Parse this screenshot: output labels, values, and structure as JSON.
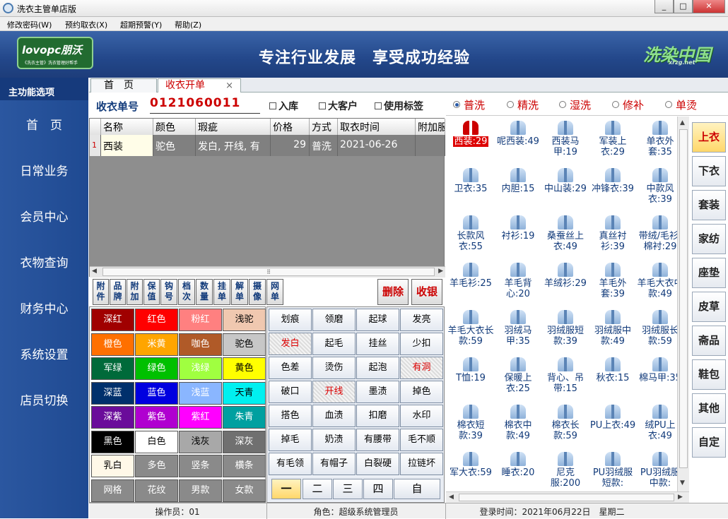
{
  "window": {
    "title": "洗衣主管单店版",
    "min": "0",
    "max": "1",
    "close": "r"
  },
  "menu": [
    "修改密码(W)",
    "预约取衣(X)",
    "超期预警(Y)",
    "帮助(Z)"
  ],
  "banner": {
    "logo_left": "lovopc朋沃",
    "logo_left_sub": "《洗衣主管》洗衣管理好帮手",
    "slogan": "专注行业发展　享受成功经验",
    "logo_right": "洗染中国",
    "logo_right_sub": "xrzg.net"
  },
  "sidebar": {
    "header": "主功能选项",
    "items": [
      "首　页",
      "日常业务",
      "会员中心",
      "衣物查询",
      "财务中心",
      "系统设置",
      "店员切换"
    ]
  },
  "tabs": [
    {
      "label": "首　页"
    },
    {
      "label": "收衣开单",
      "close": "×"
    }
  ],
  "form": {
    "order_label": "收衣单号",
    "order_no": "0121060011",
    "checks": [
      "入库",
      "大客户",
      "使用标签"
    ]
  },
  "grid": {
    "headers": [
      "名称",
      "颜色",
      "瑕疵",
      "价格",
      "方式",
      "取衣时间",
      "附加服"
    ],
    "row": {
      "index": "1",
      "name": "西装",
      "color": "驼色",
      "defect": "发白, 开线, 有",
      "price": "29",
      "method": "普洗",
      "time": "2021-06-26"
    },
    "scroll_grip": "⠿"
  },
  "toolbar": {
    "buttons": [
      "附件",
      "品牌",
      "附加",
      "保值",
      "钩号",
      "档次",
      "数量",
      "挂单",
      "解单",
      "摄像",
      "网单"
    ],
    "delete": "删除",
    "checkout": "收银"
  },
  "colors": [
    {
      "n": "深红",
      "bg": "#a00000",
      "fg": "#fff"
    },
    {
      "n": "红色",
      "bg": "#ff0000",
      "fg": "#fff"
    },
    {
      "n": "粉红",
      "bg": "#ff8080",
      "fg": "#fff"
    },
    {
      "n": "浅驼",
      "bg": "#f0c8b0",
      "fg": "#000"
    },
    {
      "n": "橙色",
      "bg": "#ff7000",
      "fg": "#fff"
    },
    {
      "n": "米黄",
      "bg": "#ffa500",
      "fg": "#fff"
    },
    {
      "n": "咖色",
      "bg": "#b05a28",
      "fg": "#fff"
    },
    {
      "n": "驼色",
      "bg": "#c7c7c7",
      "fg": "#000"
    },
    {
      "n": "军绿",
      "bg": "#006a3a",
      "fg": "#fff"
    },
    {
      "n": "绿色",
      "bg": "#00c000",
      "fg": "#fff"
    },
    {
      "n": "浅绿",
      "bg": "#a0ff40",
      "fg": "#fff"
    },
    {
      "n": "黄色",
      "bg": "#ffff00",
      "fg": "#000"
    },
    {
      "n": "深蓝",
      "bg": "#00306c",
      "fg": "#fff"
    },
    {
      "n": "蓝色",
      "bg": "#0000e0",
      "fg": "#fff"
    },
    {
      "n": "浅蓝",
      "bg": "#8ab6ff",
      "fg": "#fff"
    },
    {
      "n": "天青",
      "bg": "#00f0f0",
      "fg": "#000"
    },
    {
      "n": "深紫",
      "bg": "#6a0c9a",
      "fg": "#fff"
    },
    {
      "n": "紫色",
      "bg": "#b000d0",
      "fg": "#fff"
    },
    {
      "n": "紫红",
      "bg": "#ff00ff",
      "fg": "#fff"
    },
    {
      "n": "朱青",
      "bg": "#00a0a0",
      "fg": "#fff"
    },
    {
      "n": "黑色",
      "bg": "#000000",
      "fg": "#fff"
    },
    {
      "n": "白色",
      "bg": "#ffffff",
      "fg": "#000"
    },
    {
      "n": "浅灰",
      "bg": "#a8a8a8",
      "fg": "#000"
    },
    {
      "n": "深灰",
      "bg": "#707070",
      "fg": "#fff"
    },
    {
      "n": "乳白",
      "bg": "#fff8e8",
      "fg": "#000"
    },
    {
      "n": "多色",
      "bg": "#8a8a8a",
      "fg": "#fff"
    },
    {
      "n": "竖条",
      "bg": "#8a8a8a",
      "fg": "#fff"
    },
    {
      "n": "横条",
      "bg": "#8a8a8a",
      "fg": "#fff"
    },
    {
      "n": "网格",
      "bg": "#8a8a8a",
      "fg": "#fff"
    },
    {
      "n": "花纹",
      "bg": "#8a8a8a",
      "fg": "#fff"
    },
    {
      "n": "男款",
      "bg": "#8a8a8a",
      "fg": "#fff"
    },
    {
      "n": "女款",
      "bg": "#8a8a8a",
      "fg": "#fff"
    }
  ],
  "defects": [
    {
      "n": "划痕"
    },
    {
      "n": "领磨"
    },
    {
      "n": "起球"
    },
    {
      "n": "发亮"
    },
    {
      "n": "发白",
      "sel": true
    },
    {
      "n": "起毛"
    },
    {
      "n": "挂丝"
    },
    {
      "n": "少扣"
    },
    {
      "n": "色差"
    },
    {
      "n": "烫伤"
    },
    {
      "n": "起泡"
    },
    {
      "n": "有洞",
      "sel": true
    },
    {
      "n": "破口"
    },
    {
      "n": "开线",
      "sel": true
    },
    {
      "n": "墨渍"
    },
    {
      "n": "掉色"
    },
    {
      "n": "搭色"
    },
    {
      "n": "血渍"
    },
    {
      "n": "扣磨"
    },
    {
      "n": "水印"
    },
    {
      "n": "掉毛"
    },
    {
      "n": "奶渍"
    },
    {
      "n": "有腰带"
    },
    {
      "n": "毛不顺"
    },
    {
      "n": "有毛领"
    },
    {
      "n": "有帽子"
    },
    {
      "n": "白裂硬"
    },
    {
      "n": "拉链坏"
    }
  ],
  "pager": [
    "一",
    "二",
    "三",
    "四",
    "自"
  ],
  "wash_modes": [
    "普洗",
    "精洗",
    "湿洗",
    "修补",
    "单烫"
  ],
  "items": [
    "西装:29",
    "呢西装:49",
    "西装马甲:19",
    "军装上衣:29",
    "单衣外套:35",
    "卫衣:35",
    "内胆:15",
    "中山装:29",
    "冲锋衣:39",
    "中款风衣:39",
    "长款风衣:55",
    "衬衫:19",
    "桑蚕丝上衣:49",
    "真丝衬衫:39",
    "带绒/毛衫/棉衬:29",
    "羊毛衫:25",
    "羊毛背心:20",
    "羊绒衫:29",
    "羊毛外套:39",
    "羊毛大衣中款:49",
    "羊毛大衣长款:59",
    "羽绒马甲:35",
    "羽绒服短款:39",
    "羽绒服中款:49",
    "羽绒服长款:59",
    "T恤:19",
    "保暖上衣:25",
    "背心、吊带:15",
    "秋衣:15",
    "棉马甲:35",
    "棉衣短款:39",
    "棉衣中款:49",
    "棉衣长款:59",
    "PU上衣:49",
    "绒PU上衣:49",
    "军大衣:59",
    "睡衣:20",
    "尼克服:200",
    "PU羽绒服短款:",
    "PU羽绒服中款:"
  ],
  "categories": [
    "上衣",
    "下衣",
    "套装",
    "家纺",
    "座垫",
    "皮草",
    "斋品",
    "鞋包",
    "其他",
    "自定"
  ],
  "status": {
    "operator": "操作员：01",
    "role": "角色：超级系统管理员",
    "login": "登录时间：2021年06月22日　星期二"
  }
}
